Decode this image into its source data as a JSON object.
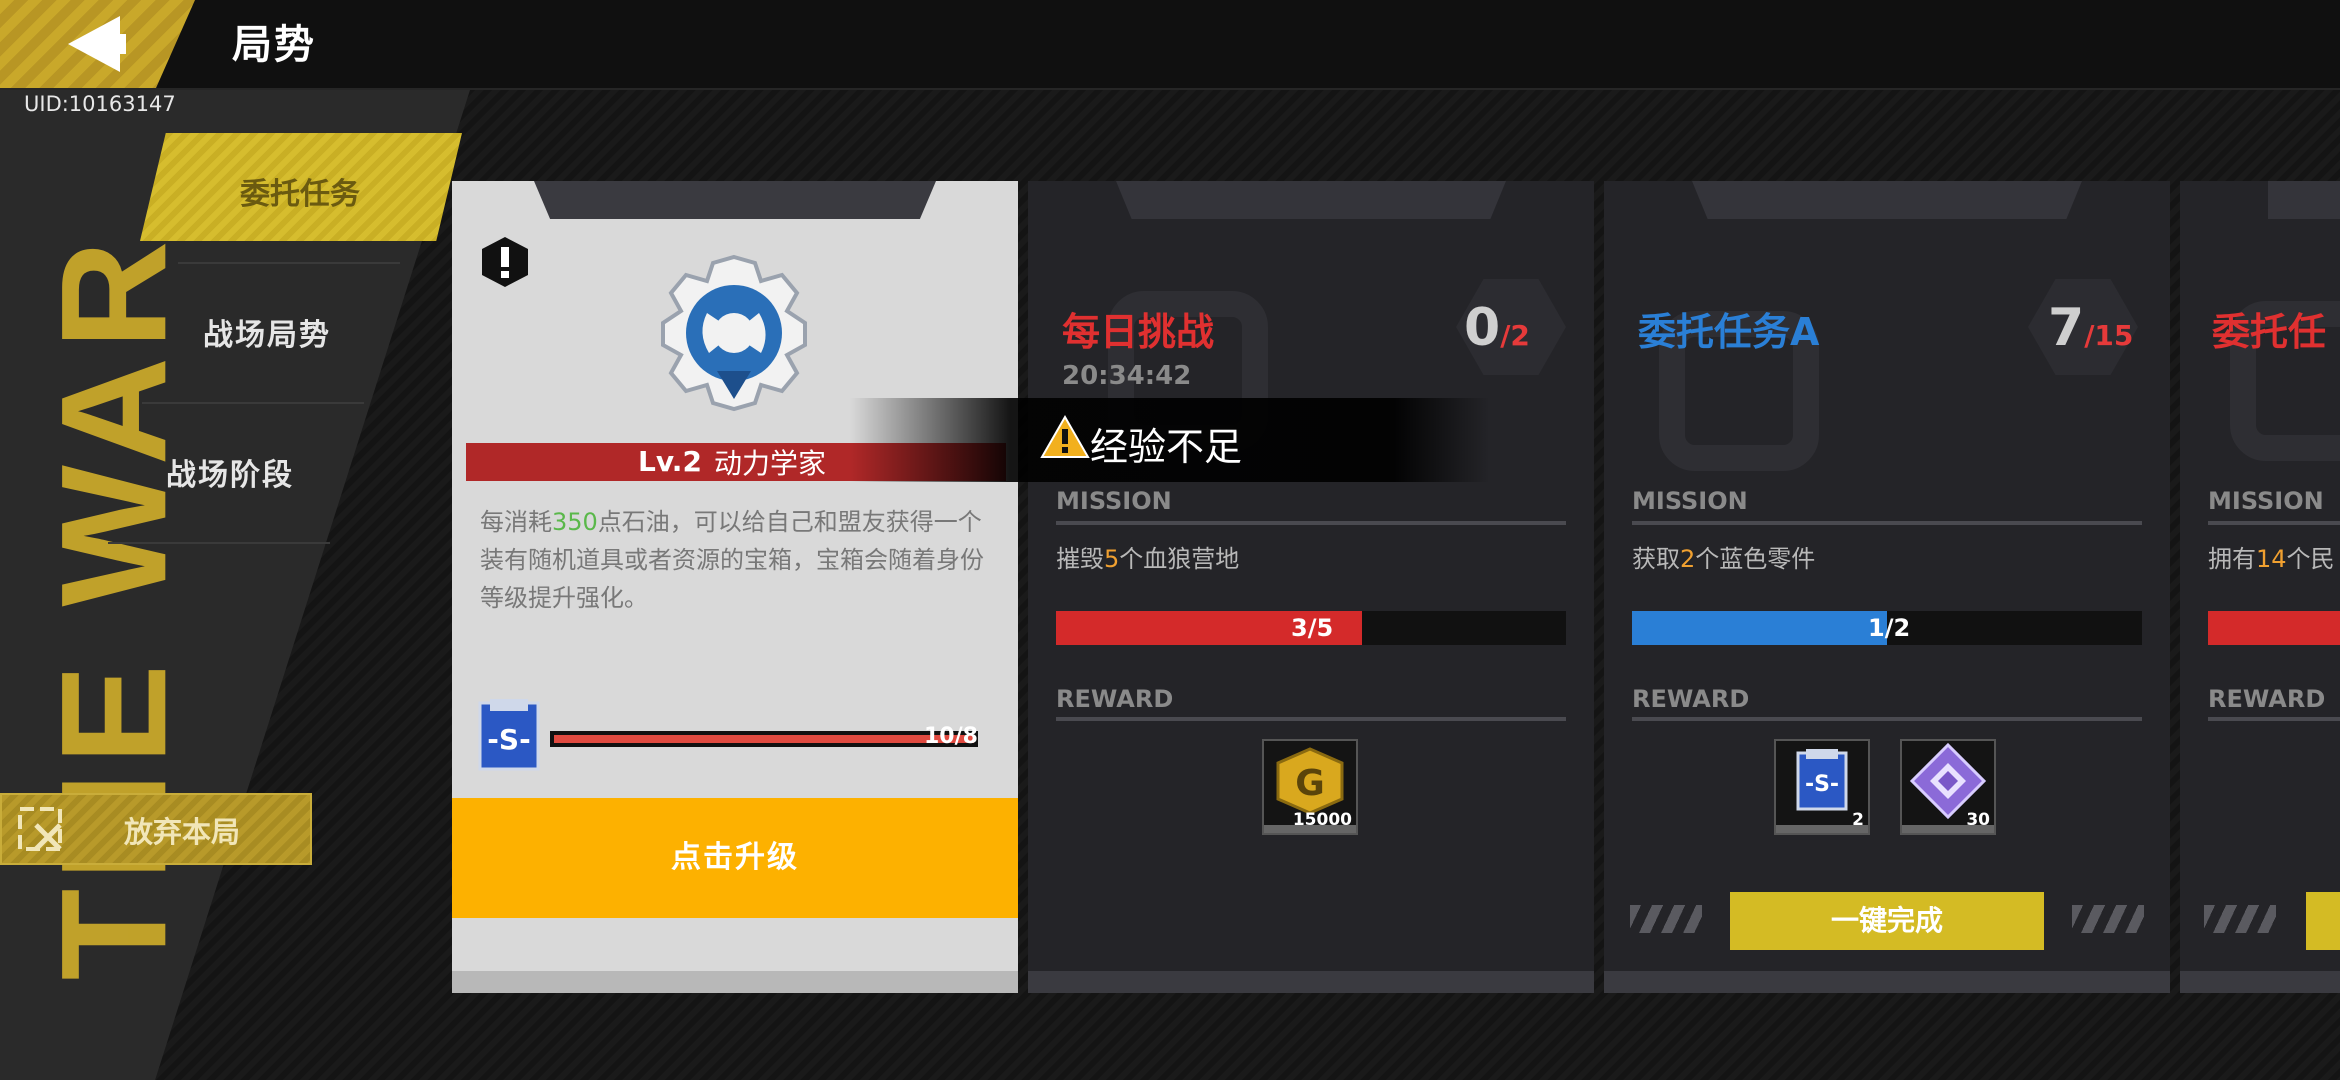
{
  "header": {
    "title": "局势",
    "uid": "UID:10163147",
    "back_icon": "back-arrow-icon"
  },
  "sidebar": {
    "watermark": "THE WAR",
    "items": [
      {
        "label": "委托任务",
        "active": true
      },
      {
        "label": "战场局势",
        "active": false
      },
      {
        "label": "战场阶段",
        "active": false
      }
    ],
    "abandon_label": "放弃本局"
  },
  "skill_card": {
    "level": "Lv.2",
    "name": "动力学家",
    "desc_prefix": "每消耗",
    "desc_num": "350",
    "desc_suffix": "点石油，可以给自己和盟友获得一个装有随机道具或者资源的宝箱，宝箱会随着身份等级提升强化。",
    "progress_text": "10/8",
    "progress": 1.0,
    "chip_label": "-S-",
    "upgrade_label": "点击升级"
  },
  "toast": {
    "text": "经验不足"
  },
  "cards": [
    {
      "title": "每日挑战",
      "title_color": "#e03030",
      "timer": "20:34:42",
      "count": "0",
      "total": "/2",
      "mission_label": "MISSION",
      "desc_pre": "摧毁",
      "desc_num": "5",
      "desc_post": "个血狼营地",
      "progress_text": "3/5",
      "progress": 0.6,
      "bar_color": "#d42a2a",
      "reward_label": "REWARD",
      "rewards": [
        {
          "icon": "gold-coin-icon",
          "qty": "15000"
        }
      ]
    },
    {
      "title": "委托任务A",
      "title_color": "#2a7fd6",
      "count": "7",
      "total": "/15",
      "mission_label": "MISSION",
      "desc_pre": "获取",
      "desc_num": "2",
      "desc_post": "个蓝色零件",
      "progress_text": "1/2",
      "progress": 0.5,
      "bar_color": "#2a7fd6",
      "reward_label": "REWARD",
      "rewards": [
        {
          "icon": "s-chip-icon",
          "qty": "2"
        },
        {
          "icon": "purple-crystal-icon",
          "qty": "30"
        }
      ],
      "complete_label": "一键完成"
    },
    {
      "title": "委托任",
      "title_color": "#e03030",
      "mission_label": "MISSION",
      "desc_pre": "拥有",
      "desc_num": "14",
      "desc_post": "个民",
      "bar_color": "#d42a2a",
      "reward_label": "REWARD"
    }
  ]
}
